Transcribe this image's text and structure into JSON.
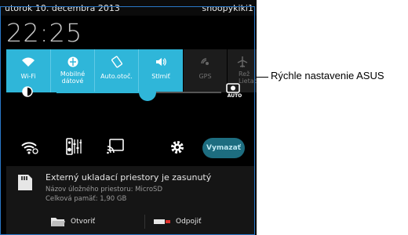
{
  "status_bar": {
    "date": "utorok 10. decembra 2013",
    "user": "snoopykiki1"
  },
  "clock": "22:25",
  "quick_settings": {
    "tiles": [
      {
        "label": "Wi-Fi",
        "icon": "wifi-icon",
        "active": true
      },
      {
        "label": "Mobilné dátové",
        "icon": "mobile-data-icon",
        "active": true
      },
      {
        "label": "Auto.otoč.",
        "icon": "auto-rotate-icon",
        "active": true
      },
      {
        "label": "Stlmiť",
        "icon": "volume-icon",
        "active": true
      },
      {
        "label": "GPS",
        "icon": "gps-icon",
        "active": false
      },
      {
        "label": "Rež Lietad",
        "icon": "airplane-mode-icon",
        "active": false
      }
    ],
    "accent_color": "#2fb6d9"
  },
  "brightness": {
    "level": 0.55,
    "auto_label": "AUTO"
  },
  "toolbar": {
    "clear_label": "Vymazať"
  },
  "notification": {
    "title": "Externý ukladací priestory je zasunutý",
    "line1": "Názov úložného priestoru: MicroSD",
    "line2": "Celková pamäť: 1,90 GB",
    "open_label": "Otvoriť",
    "disconnect_label": "Odpojiť"
  },
  "callout": "Rýchle nastavenie ASUS"
}
